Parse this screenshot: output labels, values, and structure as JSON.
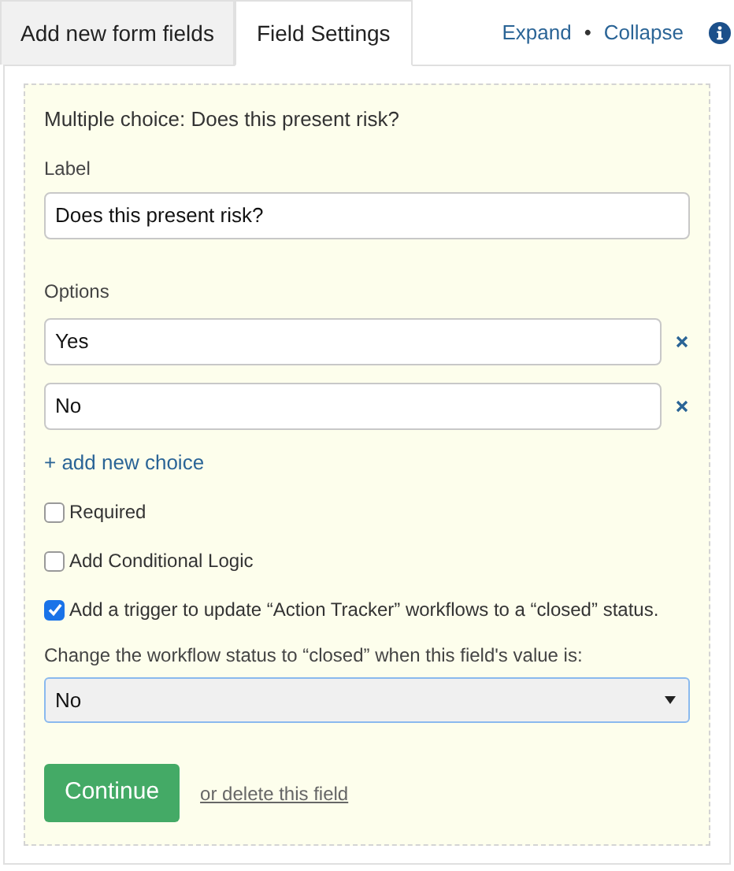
{
  "tabs": [
    {
      "label": "Add new form fields",
      "selected": false
    },
    {
      "label": "Field Settings",
      "selected": true
    }
  ],
  "header_links": [
    {
      "label": "Expand"
    },
    {
      "label": "Collapse"
    }
  ],
  "separator": "•",
  "field": {
    "title": "Multiple choice: Does this present risk?",
    "label_caption": "Label",
    "label_value": "Does this present risk?",
    "options_caption": "Options",
    "options": [
      {
        "value": "Yes"
      },
      {
        "value": "No"
      }
    ],
    "add_choice": "+ add new choice",
    "checkboxes": [
      {
        "label": "Required",
        "checked": false
      },
      {
        "label": "Add Conditional Logic",
        "checked": false
      },
      {
        "label": "Add a trigger to update “Action Tracker” workflows to a “closed” status.",
        "checked": true
      }
    ],
    "status_caption": "Change the workflow status to “closed” when this field's value is:",
    "status_value": "No",
    "continue_button": "Continue",
    "delete_link": "or delete this field"
  }
}
